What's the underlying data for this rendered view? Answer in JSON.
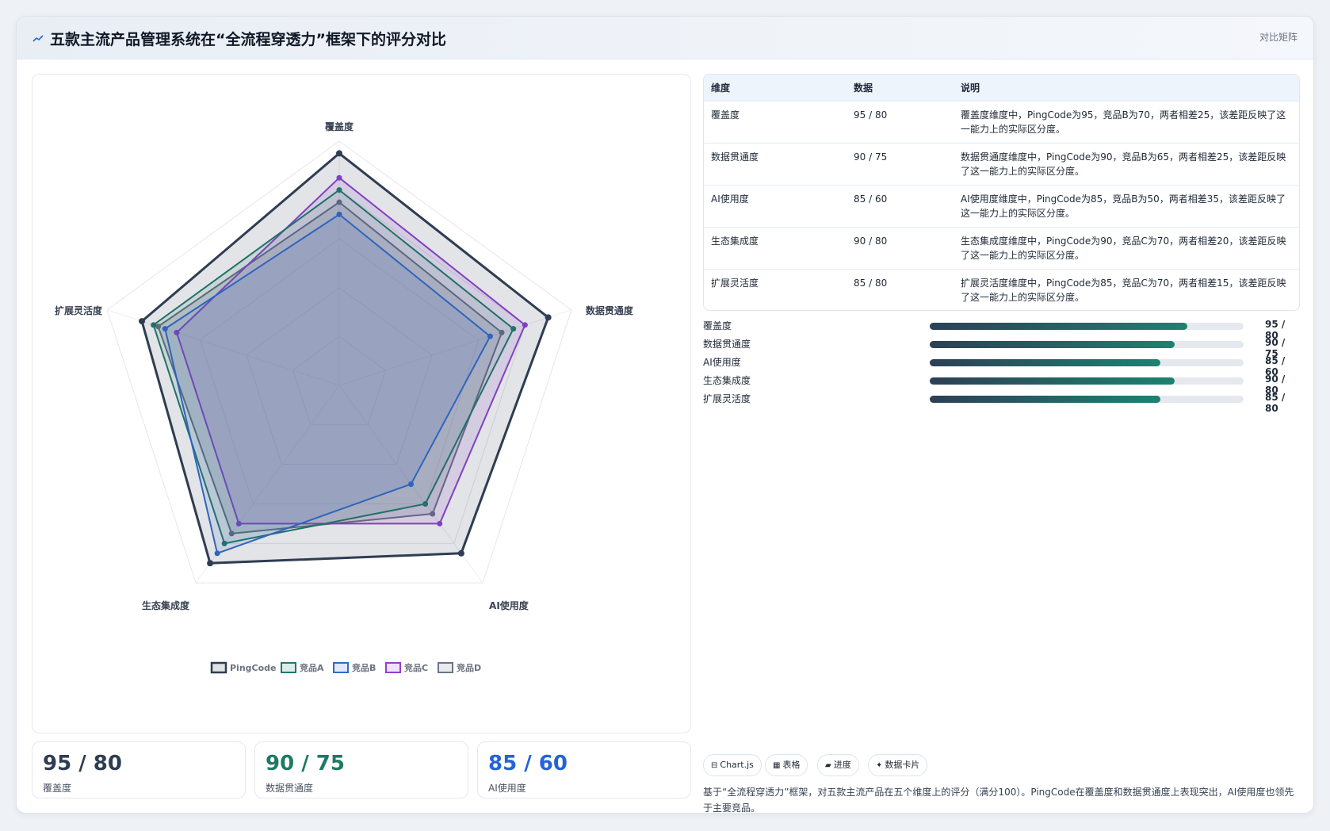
{
  "header": {
    "title": "五款主流产品管理系统在“全流程穿透力”框架下的评分对比",
    "tag": "对比矩阵"
  },
  "chart_data": {
    "type": "radar",
    "axes": [
      "覆盖度",
      "数据贯通度",
      "AI使用度",
      "生态集成度",
      "扩展灵活度"
    ],
    "range": [
      0,
      100
    ],
    "series": [
      {
        "name": "PingCode",
        "values": [
          95,
          90,
          85,
          90,
          85
        ],
        "color": "#2f3d52"
      },
      {
        "name": "竞品A",
        "values": [
          80,
          75,
          60,
          80,
          80
        ],
        "color": "#1f7a6b"
      },
      {
        "name": "竞品B",
        "values": [
          70,
          65,
          50,
          85,
          75
        ],
        "color": "#2f6ad0"
      },
      {
        "name": "竞品C",
        "values": [
          85,
          80,
          70,
          70,
          70
        ],
        "color": "#8f3fd6"
      },
      {
        "name": "竞品D",
        "values": [
          75,
          70,
          65,
          75,
          78
        ],
        "color": "#697485"
      }
    ],
    "legend_position": "bottom"
  },
  "kpis": [
    {
      "value": "95 / 80",
      "label": "覆盖度",
      "color": "#2f3d52"
    },
    {
      "value": "90 / 75",
      "label": "数据贯通度",
      "color": "#1d7a66"
    },
    {
      "value": "85 / 60",
      "label": "AI使用度",
      "color": "#2563d8"
    }
  ],
  "table": {
    "headers": [
      "维度",
      "数据",
      "说明"
    ],
    "rows": [
      {
        "dim": "覆盖度",
        "val": "95 / 80",
        "desc": "覆盖度维度中，PingCode为95，竞品B为70，两者相差25，该差距反映了这一能力上的实际区分度。"
      },
      {
        "dim": "数据贯通度",
        "val": "90 / 75",
        "desc": "数据贯通度维度中，PingCode为90，竞品B为65，两者相差25，该差距反映了这一能力上的实际区分度。"
      },
      {
        "dim": "AI使用度",
        "val": "85 / 60",
        "desc": "AI使用度维度中，PingCode为85，竞品B为50，两者相差35，该差距反映了这一能力上的实际区分度。"
      },
      {
        "dim": "生态集成度",
        "val": "90 / 80",
        "desc": "生态集成度维度中，PingCode为90，竞品C为70，两者相差20，该差距反映了这一能力上的实际区分度。"
      },
      {
        "dim": "扩展灵活度",
        "val": "85 / 80",
        "desc": "扩展灵活度维度中，PingCode为85，竞品C为70，两者相差15，该差距反映了这一能力上的实际区分度。"
      }
    ]
  },
  "progress": [
    {
      "label": "覆盖度",
      "value": "95 / 80",
      "pct": 0.82
    },
    {
      "label": "数据贯通度",
      "value": "90 / 75",
      "pct": 0.78
    },
    {
      "label": "AI使用度",
      "value": "85 / 60",
      "pct": 0.735
    },
    {
      "label": "生态集成度",
      "value": "90 / 80",
      "pct": 0.78
    },
    {
      "label": "扩展灵活度",
      "value": "85 / 80",
      "pct": 0.735
    }
  ],
  "chips": [
    {
      "icon": "⊟",
      "label": "Chart.js"
    },
    {
      "icon": "▦",
      "label": "表格"
    },
    {
      "icon": "▰",
      "label": "进度"
    },
    {
      "icon": "✦",
      "label": "数据卡片"
    }
  ],
  "summary": "基于“全流程穿透力”框架，对五款主流产品在五个维度上的评分（满分100）。PingCode在覆盖度和数据贯通度上表现突出，AI使用度也领先于主要竞品。"
}
